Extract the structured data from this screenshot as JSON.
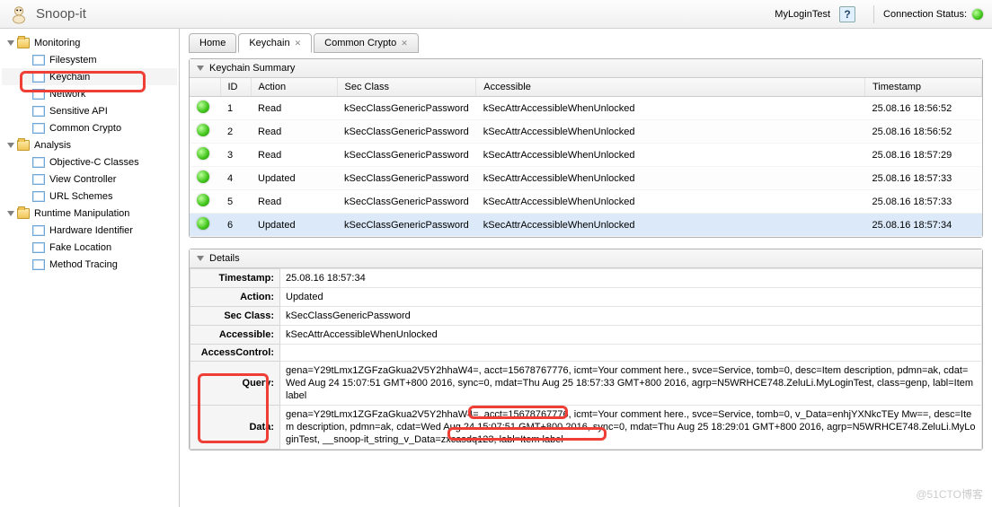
{
  "header": {
    "title": "Snoop-it",
    "user": "MyLoginTest",
    "conn_label": "Connection Status:"
  },
  "sidebar": {
    "groups": [
      {
        "label": "Monitoring",
        "items": [
          "Filesystem",
          "Keychain",
          "Network",
          "Sensitive API",
          "Common Crypto"
        ]
      },
      {
        "label": "Analysis",
        "items": [
          "Objective-C Classes",
          "View Controller",
          "URL Schemes"
        ]
      },
      {
        "label": "Runtime Manipulation",
        "items": [
          "Hardware Identifier",
          "Fake Location",
          "Method Tracing"
        ]
      }
    ],
    "selected": "Keychain"
  },
  "tabs": [
    {
      "label": "Home",
      "closable": false,
      "active": false
    },
    {
      "label": "Keychain",
      "closable": true,
      "active": true
    },
    {
      "label": "Common Crypto",
      "closable": true,
      "active": false
    }
  ],
  "summary": {
    "title": "Keychain Summary",
    "cols": [
      "",
      "ID",
      "Action",
      "Sec Class",
      "Accessible",
      "Timestamp"
    ],
    "rows": [
      {
        "id": "1",
        "action": "Read",
        "sec": "kSecClassGenericPassword",
        "acc": "kSecAttrAccessibleWhenUnlocked",
        "ts": "25.08.16 18:56:52"
      },
      {
        "id": "2",
        "action": "Read",
        "sec": "kSecClassGenericPassword",
        "acc": "kSecAttrAccessibleWhenUnlocked",
        "ts": "25.08.16 18:56:52"
      },
      {
        "id": "3",
        "action": "Read",
        "sec": "kSecClassGenericPassword",
        "acc": "kSecAttrAccessibleWhenUnlocked",
        "ts": "25.08.16 18:57:29"
      },
      {
        "id": "4",
        "action": "Updated",
        "sec": "kSecClassGenericPassword",
        "acc": "kSecAttrAccessibleWhenUnlocked",
        "ts": "25.08.16 18:57:33"
      },
      {
        "id": "5",
        "action": "Read",
        "sec": "kSecClassGenericPassword",
        "acc": "kSecAttrAccessibleWhenUnlocked",
        "ts": "25.08.16 18:57:33"
      },
      {
        "id": "6",
        "action": "Updated",
        "sec": "kSecClassGenericPassword",
        "acc": "kSecAttrAccessibleWhenUnlocked",
        "ts": "25.08.16 18:57:34"
      }
    ],
    "selected": 5
  },
  "details": {
    "title": "Details",
    "rows": [
      {
        "k": "Timestamp:",
        "v": "25.08.16 18:57:34"
      },
      {
        "k": "Action:",
        "v": "Updated"
      },
      {
        "k": "Sec Class:",
        "v": "kSecClassGenericPassword"
      },
      {
        "k": "Accessible:",
        "v": "kSecAttrAccessibleWhenUnlocked"
      },
      {
        "k": "AccessControl:",
        "v": ""
      },
      {
        "k": "Query:",
        "v": "gena=Y29tLmx1ZGFzaGkua2V5Y2hhaW4=, acct=15678767776, icmt=Your comment here., svce=Service, tomb=0, desc=Item description, pdmn=ak, cdat=Wed Aug 24 15:07:51 GMT+800 2016, sync=0, mdat=Thu Aug 25 18:57:33 GMT+800 2016, agrp=N5WRHCE748.ZeluLi.MyLoginTest, class=genp, labl=Item label"
      },
      {
        "k": "Data:",
        "v": "gena=Y29tLmx1ZGFzaGkua2V5Y2hhaW4=, acct=15678767776, icmt=Your comment here., svce=Service, tomb=0, v_Data=enhjYXNkcTEy Mw==, desc=Item description, pdmn=ak, cdat=Wed Aug 24 15:07:51 GMT+800 2016, sync=0, mdat=Thu Aug 25 18:29:01 GMT+800 2016, agrp=N5WRHCE748.ZeluLi.MyLoginTest, __snoop-it_string_v_Data=zxcasdq123, labl=Item label"
      }
    ]
  },
  "watermark": "@51CTO博客"
}
